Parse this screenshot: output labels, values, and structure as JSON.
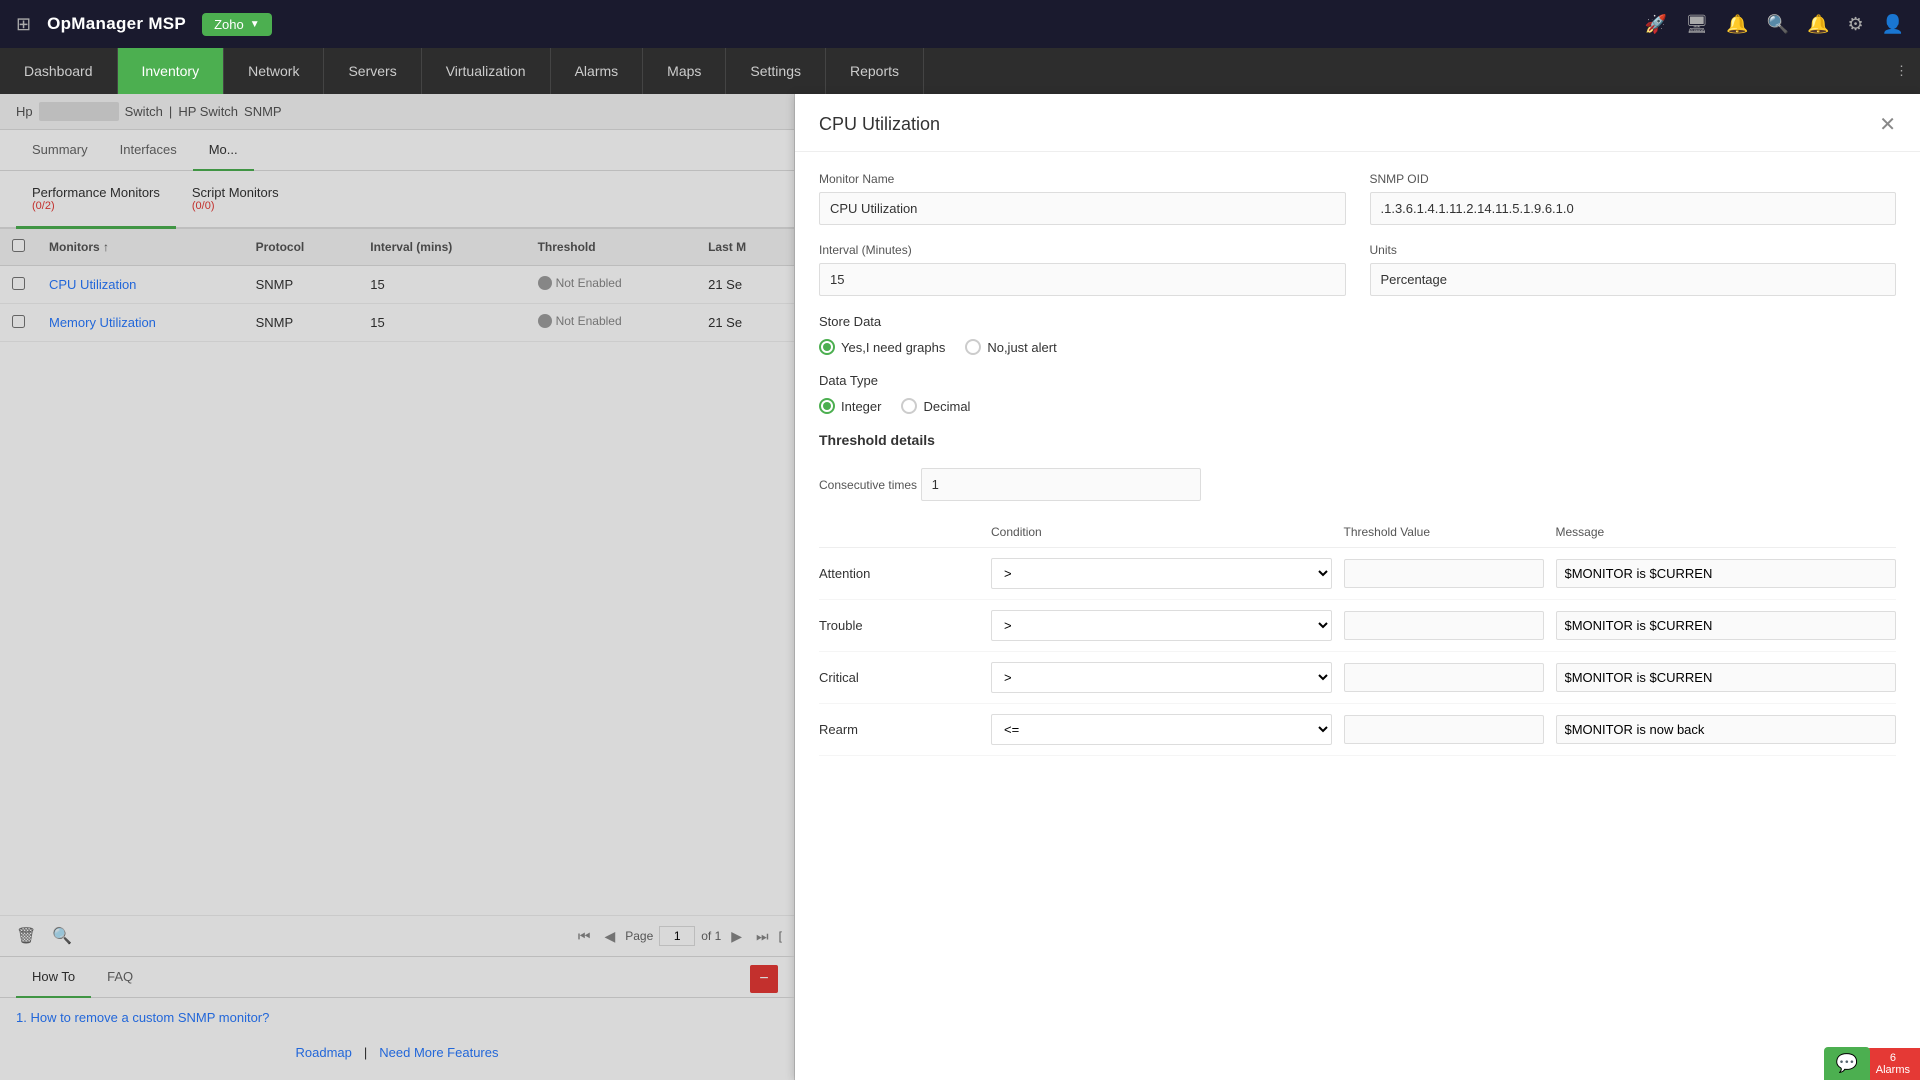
{
  "app": {
    "title": "OpManager MSP",
    "org": "Zoho"
  },
  "topbar": {
    "icons": [
      "rocket",
      "monitor",
      "bell-alert",
      "search",
      "bell",
      "settings",
      "user"
    ]
  },
  "navbar": {
    "items": [
      {
        "label": "Dashboard",
        "active": false
      },
      {
        "label": "Inventory",
        "active": true
      },
      {
        "label": "Network",
        "active": false
      },
      {
        "label": "Servers",
        "active": false
      },
      {
        "label": "Virtualization",
        "active": false
      },
      {
        "label": "Alarms",
        "active": false
      },
      {
        "label": "Maps",
        "active": false
      },
      {
        "label": "Settings",
        "active": false
      },
      {
        "label": "Reports",
        "active": false
      }
    ]
  },
  "breadcrumb": {
    "device": "Hp",
    "type": "Switch",
    "subtype": "HP Switch",
    "protocol": "SNMP"
  },
  "sub_tabs": [
    {
      "label": "Summary"
    },
    {
      "label": "Interfaces"
    },
    {
      "label": "Mo..."
    }
  ],
  "monitor_tabs": [
    {
      "label": "Performance Monitors",
      "count": "(0/2)",
      "active": true
    },
    {
      "label": "Script Monitors",
      "count": "(0/0)",
      "active": false
    }
  ],
  "table": {
    "columns": [
      "Monitors",
      "Protocol",
      "Interval (mins)",
      "Threshold",
      "Last M"
    ],
    "rows": [
      {
        "name": "CPU Utilization",
        "protocol": "SNMP",
        "interval": "15",
        "threshold": "Not Enabled",
        "last": "21 Se"
      },
      {
        "name": "Memory Utilization",
        "protocol": "SNMP",
        "interval": "15",
        "threshold": "Not Enabled",
        "last": "21 Se"
      }
    ],
    "pagination": {
      "page": "1",
      "of": "of 1"
    }
  },
  "bottom_section": {
    "tabs": [
      {
        "label": "How To",
        "active": true
      },
      {
        "label": "FAQ",
        "active": false
      }
    ],
    "how_to_items": [
      "1. How to remove a custom SNMP monitor?"
    ],
    "links": {
      "roadmap": "Roadmap",
      "separator": "|",
      "features": "Need More Features"
    }
  },
  "cpu_panel": {
    "title": "CPU Utilization",
    "fields": {
      "monitor_name_label": "Monitor Name",
      "monitor_name_value": "CPU Utilization",
      "snmp_oid_label": "SNMP OID",
      "snmp_oid_value": ".1.3.6.1.4.1.11.2.14.11.5.1.9.6.1.0",
      "interval_label": "Interval (Minutes)",
      "interval_value": "15",
      "units_label": "Units",
      "units_value": "Percentage",
      "store_data_label": "Store Data",
      "store_data_options": [
        {
          "label": "Yes,I need graphs",
          "selected": true
        },
        {
          "label": "No,just alert",
          "selected": false
        }
      ],
      "data_type_label": "Data Type",
      "data_type_options": [
        {
          "label": "Integer",
          "selected": true
        },
        {
          "label": "Decimal",
          "selected": false
        }
      ]
    },
    "threshold": {
      "title": "Threshold details",
      "consecutive_times_label": "Consecutive times",
      "consecutive_times_value": "1",
      "columns": [
        "",
        "Condition",
        "Threshold Value",
        "Message"
      ],
      "rows": [
        {
          "severity": "Attention",
          "condition": ">",
          "value": "",
          "message": "$MONITOR is $CURREN"
        },
        {
          "severity": "Trouble",
          "condition": ">",
          "value": "",
          "message": "$MONITOR is $CURREN"
        },
        {
          "severity": "Critical",
          "condition": ">",
          "value": "",
          "message": "$MONITOR is $CURREN"
        },
        {
          "severity": "Rearm",
          "condition": "<=",
          "value": "",
          "message": "$MONITOR is now back"
        }
      ]
    }
  },
  "alarms": {
    "count": "6",
    "label": "Alarms"
  }
}
